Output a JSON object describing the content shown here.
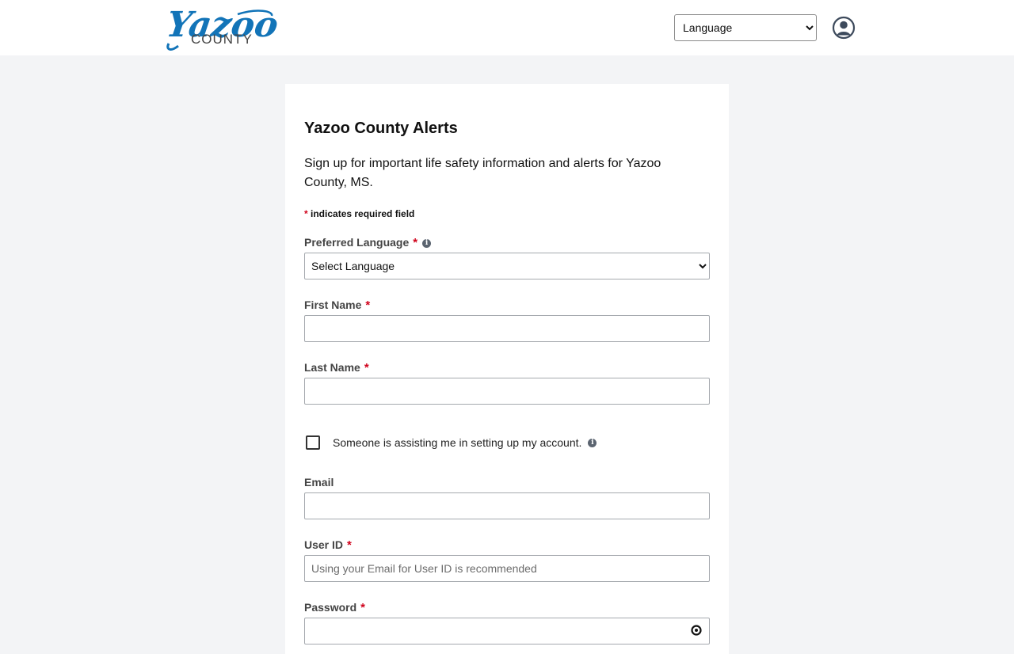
{
  "header": {
    "logo": {
      "script_text": "Yazoo",
      "sub_text": "COUNTY"
    },
    "language_select": {
      "selected": "Language"
    },
    "account_icon": "user-circle-icon"
  },
  "form": {
    "title": "Yazoo County Alerts",
    "intro": "Sign up for important life safety information and alerts for Yazoo County, MS.",
    "required_note": {
      "star": "*",
      "text": "indicates required field"
    },
    "preferred_language": {
      "label": "Preferred Language",
      "star": "*",
      "info_icon": "info-icon",
      "selected": "Select Language"
    },
    "first_name": {
      "label": "First Name",
      "star": "*",
      "value": ""
    },
    "last_name": {
      "label": "Last Name",
      "star": "*",
      "value": ""
    },
    "assisting": {
      "label": "Someone is assisting me in setting up my account.",
      "checked": false,
      "info_icon": "info-icon"
    },
    "email": {
      "label": "Email",
      "value": ""
    },
    "user_id": {
      "label": "User ID",
      "star": "*",
      "placeholder": "Using your Email for User ID is recommended"
    },
    "password": {
      "label": "Password",
      "star": "*",
      "show_icon": "eye-icon"
    }
  },
  "colors": {
    "brand_blue": "#1274b8",
    "required_red": "#d0021b",
    "page_bg": "#f3f4f6"
  }
}
